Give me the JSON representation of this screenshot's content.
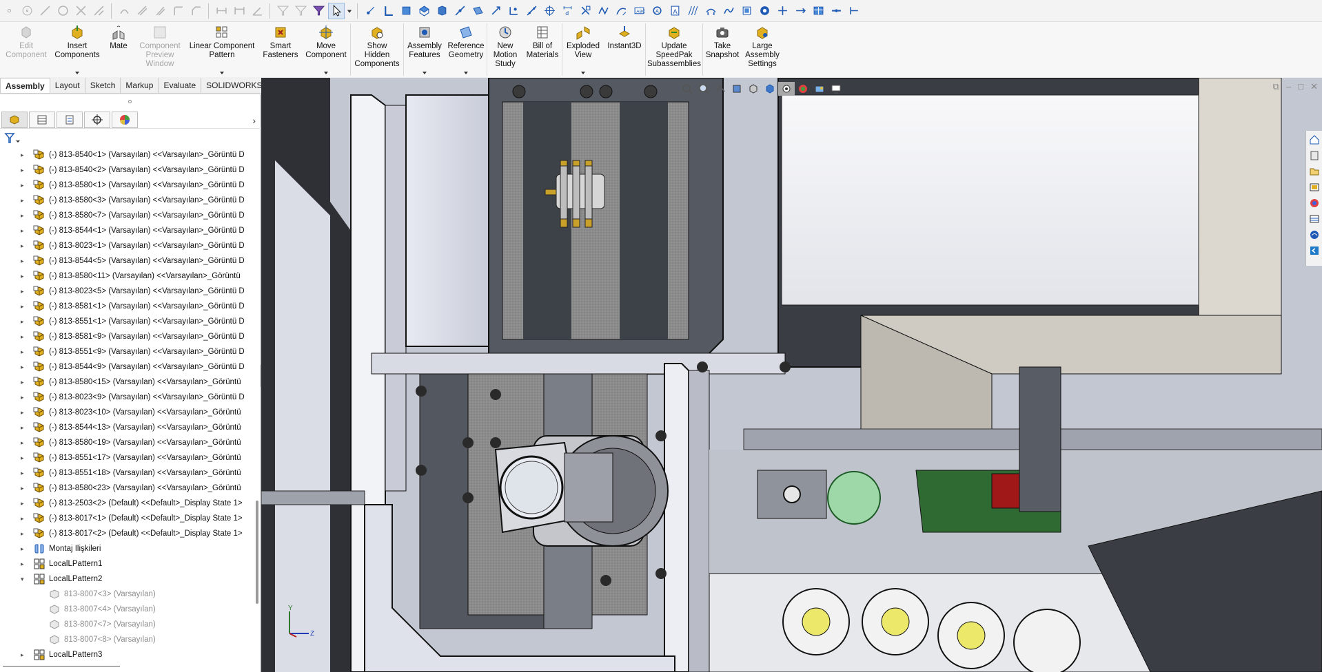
{
  "ribbon": {
    "commands": [
      {
        "id": "edit-component",
        "label": "Edit\nComponent",
        "enabled": false,
        "dropdown": false
      },
      {
        "id": "insert-components",
        "label": "Insert\nComponents",
        "enabled": true,
        "dropdown": true
      },
      {
        "id": "mate",
        "label": "Mate",
        "enabled": true,
        "dropdown": false
      },
      {
        "id": "component-preview-window",
        "label": "Component\nPreview\nWindow",
        "enabled": false,
        "dropdown": false
      },
      {
        "id": "linear-component-pattern",
        "label": "Linear Component\nPattern",
        "enabled": true,
        "dropdown": true
      },
      {
        "id": "smart-fasteners",
        "label": "Smart\nFasteners",
        "enabled": true,
        "dropdown": false
      },
      {
        "id": "move-component",
        "label": "Move\nComponent",
        "enabled": true,
        "dropdown": true
      },
      {
        "id": "show-hidden-components",
        "label": "Show\nHidden\nComponents",
        "enabled": true,
        "dropdown": false
      },
      {
        "id": "assembly-features",
        "label": "Assembly\nFeatures",
        "enabled": true,
        "dropdown": true
      },
      {
        "id": "reference-geometry",
        "label": "Reference\nGeometry",
        "enabled": true,
        "dropdown": true
      },
      {
        "id": "new-motion-study",
        "label": "New\nMotion\nStudy",
        "enabled": true,
        "dropdown": false
      },
      {
        "id": "bill-of-materials",
        "label": "Bill of\nMaterials",
        "enabled": true,
        "dropdown": false
      },
      {
        "id": "exploded-view",
        "label": "Exploded\nView",
        "enabled": true,
        "dropdown": true
      },
      {
        "id": "instant3d",
        "label": "Instant3D",
        "enabled": true,
        "dropdown": false
      },
      {
        "id": "update-speedpak",
        "label": "Update\nSpeedPak\nSubassemblies",
        "enabled": true,
        "dropdown": false
      },
      {
        "id": "take-snapshot",
        "label": "Take\nSnapshot",
        "enabled": true,
        "dropdown": false
      },
      {
        "id": "large-assembly-settings",
        "label": "Large\nAssembly\nSettings",
        "enabled": true,
        "dropdown": false
      }
    ]
  },
  "tabs": [
    "Assembly",
    "Layout",
    "Sketch",
    "Markup",
    "Evaluate",
    "SOLIDWORKS Add-Ins"
  ],
  "active_tab": "Assembly",
  "tree": {
    "items": [
      {
        "text": "(-) 813-8540<1> (Varsayılan) <<Varsayılan>_Görüntü D",
        "type": "part"
      },
      {
        "text": "(-) 813-8540<2> (Varsayılan) <<Varsayılan>_Görüntü D",
        "type": "part"
      },
      {
        "text": "(-) 813-8580<1> (Varsayılan) <<Varsayılan>_Görüntü D",
        "type": "part"
      },
      {
        "text": "(-) 813-8580<3> (Varsayılan) <<Varsayılan>_Görüntü D",
        "type": "part"
      },
      {
        "text": "(-) 813-8580<7> (Varsayılan) <<Varsayılan>_Görüntü D",
        "type": "part"
      },
      {
        "text": "(-) 813-8544<1> (Varsayılan) <<Varsayılan>_Görüntü D",
        "type": "part"
      },
      {
        "text": "(-) 813-8023<1> (Varsayılan) <<Varsayılan>_Görüntü D",
        "type": "part"
      },
      {
        "text": "(-) 813-8544<5> (Varsayılan) <<Varsayılan>_Görüntü D",
        "type": "part"
      },
      {
        "text": "(-) 813-8580<11> (Varsayılan) <<Varsayılan>_Görüntü",
        "type": "part"
      },
      {
        "text": "(-) 813-8023<5> (Varsayılan) <<Varsayılan>_Görüntü D",
        "type": "part"
      },
      {
        "text": "(-) 813-8581<1> (Varsayılan) <<Varsayılan>_Görüntü D",
        "type": "part"
      },
      {
        "text": "(-) 813-8551<1> (Varsayılan) <<Varsayılan>_Görüntü D",
        "type": "part"
      },
      {
        "text": "(-) 813-8581<9> (Varsayılan) <<Varsayılan>_Görüntü D",
        "type": "part"
      },
      {
        "text": "(-) 813-8551<9> (Varsayılan) <<Varsayılan>_Görüntü D",
        "type": "part"
      },
      {
        "text": "(-) 813-8544<9> (Varsayılan) <<Varsayılan>_Görüntü D",
        "type": "part"
      },
      {
        "text": "(-) 813-8580<15> (Varsayılan) <<Varsayılan>_Görüntü",
        "type": "part"
      },
      {
        "text": "(-) 813-8023<9> (Varsayılan) <<Varsayılan>_Görüntü D",
        "type": "part"
      },
      {
        "text": "(-) 813-8023<10> (Varsayılan) <<Varsayılan>_Görüntü",
        "type": "part"
      },
      {
        "text": "(-) 813-8544<13> (Varsayılan) <<Varsayılan>_Görüntü",
        "type": "part"
      },
      {
        "text": "(-) 813-8580<19> (Varsayılan) <<Varsayılan>_Görüntü",
        "type": "part"
      },
      {
        "text": "(-) 813-8551<17> (Varsayılan) <<Varsayılan>_Görüntü",
        "type": "part"
      },
      {
        "text": "(-) 813-8551<18> (Varsayılan) <<Varsayılan>_Görüntü",
        "type": "part"
      },
      {
        "text": "(-) 813-8580<23> (Varsayılan) <<Varsayılan>_Görüntü",
        "type": "part"
      },
      {
        "text": "(-) 813-2503<2> (Default) <<Default>_Display State 1>",
        "type": "part"
      },
      {
        "text": "(-) 813-8017<1> (Default) <<Default>_Display State 1>",
        "type": "part"
      },
      {
        "text": "(-) 813-8017<2> (Default) <<Default>_Display State 1>",
        "type": "part"
      },
      {
        "text": "Montaj İlişkileri",
        "type": "mates"
      },
      {
        "text": "LocalLPattern1",
        "type": "pattern",
        "expanded": false
      },
      {
        "text": "LocalLPattern2",
        "type": "pattern",
        "expanded": true
      },
      {
        "text": "813-8007<3> (Varsayılan)",
        "type": "child"
      },
      {
        "text": "813-8007<4> (Varsayılan)",
        "type": "child"
      },
      {
        "text": "813-8007<7> (Varsayılan)",
        "type": "child"
      },
      {
        "text": "813-8007<8> (Varsayılan)",
        "type": "child"
      },
      {
        "text": "LocalLPattern3",
        "type": "pattern",
        "expanded": false
      }
    ]
  },
  "triad": {
    "y_label": "Y",
    "z_label": "Z"
  },
  "colors": {
    "accent_blue": "#1e5ab4",
    "part_yellow": "#e0b020",
    "gear_green": "#9fd8a8",
    "red_bracket": "#a01818"
  }
}
